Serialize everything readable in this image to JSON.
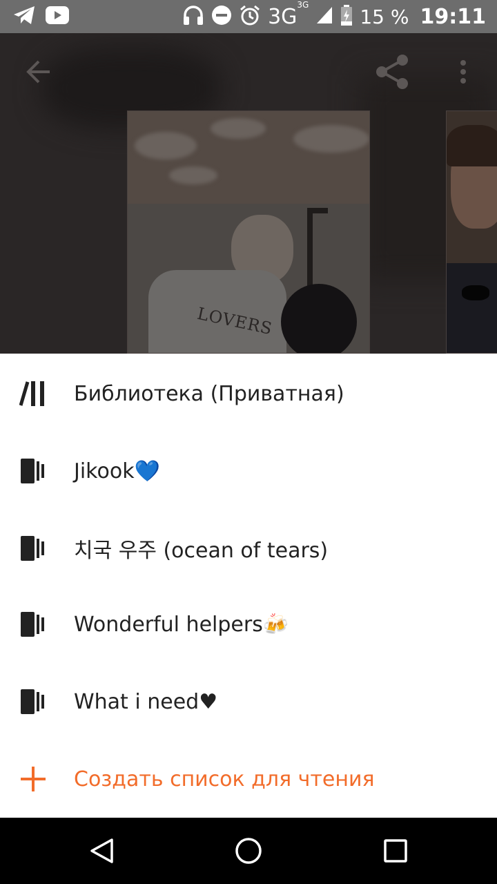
{
  "status_bar": {
    "icons_left": [
      "telegram-icon",
      "youtube-icon"
    ],
    "icons_right": [
      "headphones-icon",
      "do-not-disturb-icon",
      "alarm-icon",
      "signal-icon",
      "battery-icon"
    ],
    "network": "3G",
    "network_sup": "3G",
    "battery": "15 %",
    "time": "19:11"
  },
  "top_bar": {
    "back_icon": "arrow-back-icon",
    "share_icon": "share-icon",
    "more_icon": "more-vert-icon"
  },
  "cover": {
    "print_text": "LOVERS"
  },
  "sheet": {
    "items": [
      {
        "label": "Библиотека (Приватная)",
        "icon": "library-icon"
      },
      {
        "label": "Jikook💙",
        "icon": "reading-list-icon"
      },
      {
        "label": "치국 우주 (ocean of tears)",
        "icon": "reading-list-icon"
      },
      {
        "label": "Wonderful helpers🍻",
        "icon": "reading-list-icon"
      },
      {
        "label": "What i need♥",
        "icon": "reading-list-icon"
      }
    ],
    "create": {
      "label": "Создать список для чтения",
      "icon": "plus-icon"
    },
    "accent_color": "#f26c2a"
  },
  "nav_bar": {
    "back": "nav-back-icon",
    "home": "nav-home-icon",
    "recents": "nav-recents-icon"
  }
}
